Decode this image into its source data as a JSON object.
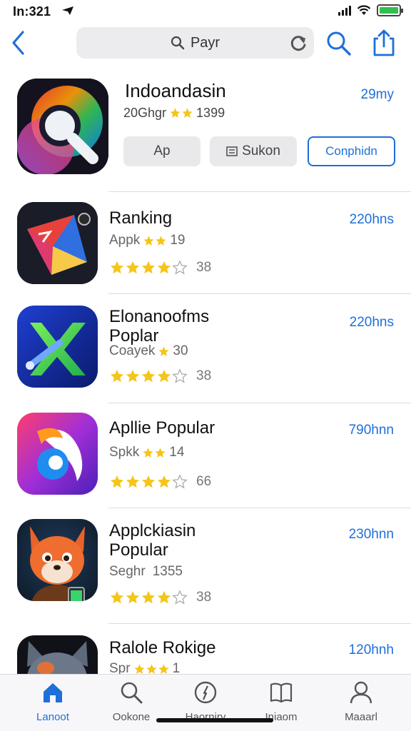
{
  "status_bar": {
    "time": "In:321"
  },
  "nav": {
    "search_text": "Payr"
  },
  "header_app": {
    "title": "Indoandasin",
    "meta_prefix": "20Ghgr",
    "meta_count": "1399",
    "size": "29my",
    "buttons": {
      "app": "Ap",
      "sukon": "Sukon",
      "download": "Conphidn"
    }
  },
  "list": [
    {
      "title_lines": [
        "Ranking"
      ],
      "subtitle_prefix": "Appk",
      "subtitle_suffix": "19",
      "rating_count": "38",
      "size": "220hns",
      "icon": "kite-icon"
    },
    {
      "title_lines": [
        "Elonanoofms",
        "Poplar"
      ],
      "subtitle_prefix": "Coayek",
      "subtitle_suffix": "30",
      "rating_count": "38",
      "size": "220hns",
      "icon": "x-shape-icon"
    },
    {
      "title_lines": [
        "Apllie Popular"
      ],
      "subtitle_prefix": "Spkk",
      "subtitle_suffix": "14",
      "rating_count": "66",
      "size": "790hnn",
      "icon": "swirl-icon"
    },
    {
      "title_lines": [
        "Applckiasin",
        "Popular"
      ],
      "subtitle_prefix": "Seghr",
      "subtitle_suffix": "1355",
      "rating_count": "38",
      "size": "230hnn",
      "icon": "fox-character-icon"
    },
    {
      "title_lines": [
        "Ralole Rokige"
      ],
      "subtitle_prefix": "Spr",
      "subtitle_suffix": "1",
      "rating_count": "",
      "size": "120hnh",
      "icon": "cat-character-icon"
    }
  ],
  "tabs": [
    {
      "label": "Lanoot",
      "icon": "home-icon",
      "active": true
    },
    {
      "label": "Ookone",
      "icon": "search-icon",
      "active": false
    },
    {
      "label": "Haorniry",
      "icon": "compass-icon",
      "active": false
    },
    {
      "label": "Iniaom",
      "icon": "book-icon",
      "active": false
    },
    {
      "label": "Maaarl",
      "icon": "person-icon",
      "active": false
    }
  ],
  "colors": {
    "accent": "#1e6fd9",
    "star": "#f5c518",
    "battery": "#30c04f"
  }
}
